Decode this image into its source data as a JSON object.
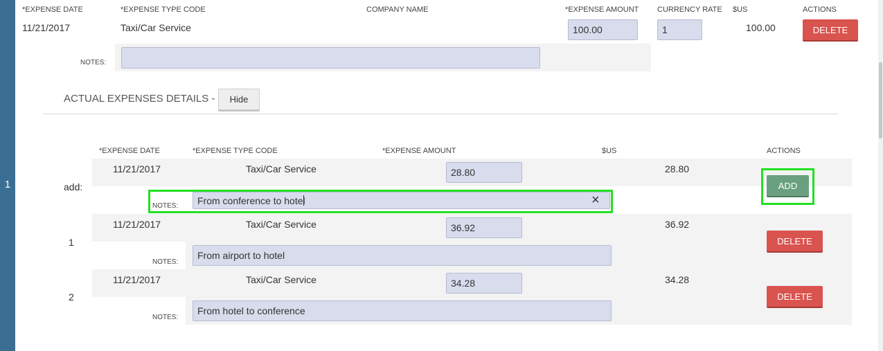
{
  "sidebar": {
    "number": "1"
  },
  "top_expense": {
    "headers": {
      "date": "*EXPENSE DATE",
      "type": "*EXPENSE TYPE CODE",
      "company": "COMPANY NAME",
      "amount": "*EXPENSE AMOUNT",
      "rate": "CURRENCY RATE",
      "usd": "$US",
      "actions": "ACTIONS"
    },
    "date": "11/21/2017",
    "type": "Taxi/Car Service",
    "amount": "100.00",
    "rate": "1",
    "usd": "100.00",
    "delete_label": "DELETE",
    "notes_label": "NOTES:",
    "notes_value": ""
  },
  "actual_details": {
    "title": "ACTUAL EXPENSES DETAILS - - 1",
    "hide_label": "Hide",
    "headers": {
      "date": "*EXPENSE DATE",
      "type": "*EXPENSE TYPE CODE",
      "amount": "*EXPENSE AMOUNT",
      "usd": "$US",
      "actions": "ACTIONS"
    },
    "add_row": {
      "row_label": "add:",
      "date": "11/21/2017",
      "type": "Taxi/Car Service",
      "amount": "28.80",
      "usd": "28.80",
      "notes_label": "NOTES:",
      "notes_value": "From conference to hotel",
      "clear_icon": "×",
      "add_label": "ADD"
    },
    "rows": [
      {
        "row_label": "1",
        "date": "11/21/2017",
        "type": "Taxi/Car Service",
        "amount": "36.92",
        "usd": "36.92",
        "notes_label": "NOTES:",
        "notes_value": "From airport to hotel",
        "delete_label": "DELETE"
      },
      {
        "row_label": "2",
        "date": "11/21/2017",
        "type": "Taxi/Car Service",
        "amount": "34.28",
        "usd": "34.28",
        "notes_label": "NOTES:",
        "notes_value": "From hotel to conference",
        "delete_label": "DELETE"
      }
    ]
  },
  "colors": {
    "sidebar": "#3a6f93",
    "input_bg": "#d8dcec",
    "delete": "#d9534f",
    "add": "#6aa07f",
    "highlight": "#22e022"
  }
}
